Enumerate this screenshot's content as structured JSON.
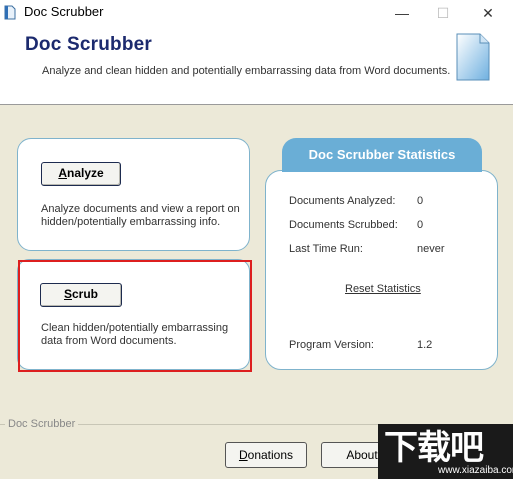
{
  "window": {
    "title": "Doc Scrubber",
    "minimize_glyph": "—",
    "maximize_glyph": "☐",
    "close_glyph": "✕"
  },
  "header": {
    "title": "Doc Scrubber",
    "subtitle": "Analyze and clean hidden and potentially embarrassing data from Word documents.",
    "icon": "document-icon"
  },
  "analyze": {
    "button_mnemonic": "A",
    "button_rest": "nalyze",
    "description_line1": "Analyze documents and view a report on",
    "description_line2": "hidden/potentially embarrassing info."
  },
  "scrub": {
    "button_mnemonic": "S",
    "button_rest": "crub",
    "description_line1": "Clean hidden/potentially embarrassing",
    "description_line2": "data from Word documents."
  },
  "statistics": {
    "title": "Doc Scrubber Statistics",
    "rows": [
      {
        "label": "Documents Analyzed:",
        "value": "0"
      },
      {
        "label": "Documents Scrubbed:",
        "value": "0"
      },
      {
        "label": "Last Time Run:",
        "value": "never"
      }
    ],
    "reset_link": "Reset Statistics",
    "version_label": "Program Version:",
    "version_value": "1.2"
  },
  "footer": {
    "group_label": "Doc Scrubber",
    "donations_mnemonic": "D",
    "donations_rest": "onations",
    "about_label": "About"
  },
  "watermark": {
    "logo_text": "下载吧",
    "url": "www.xiazaiba.com"
  },
  "colors": {
    "header_title": "#1c2a6e",
    "stats_tab": "#6aaed6",
    "highlight_frame": "#dd1f1f",
    "panel_border": "#7fb3cc"
  }
}
